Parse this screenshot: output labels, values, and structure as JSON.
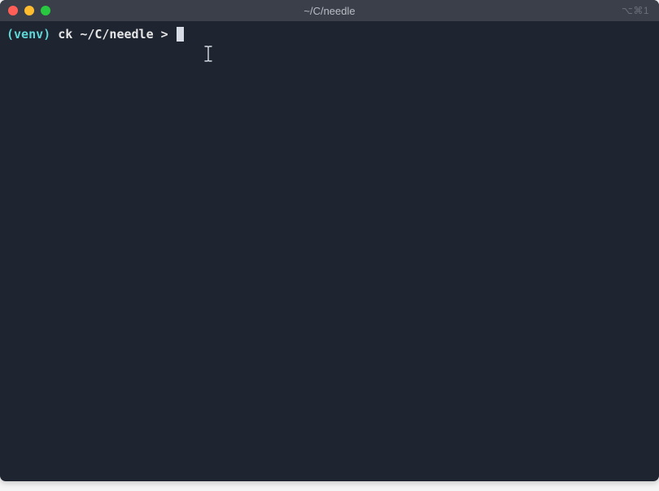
{
  "titlebar": {
    "title": "~/C/needle",
    "session": "⌥⌘1"
  },
  "prompt": {
    "venv": "(venv)",
    "user": "ck",
    "path": "~/C/needle",
    "symbol": ">"
  }
}
